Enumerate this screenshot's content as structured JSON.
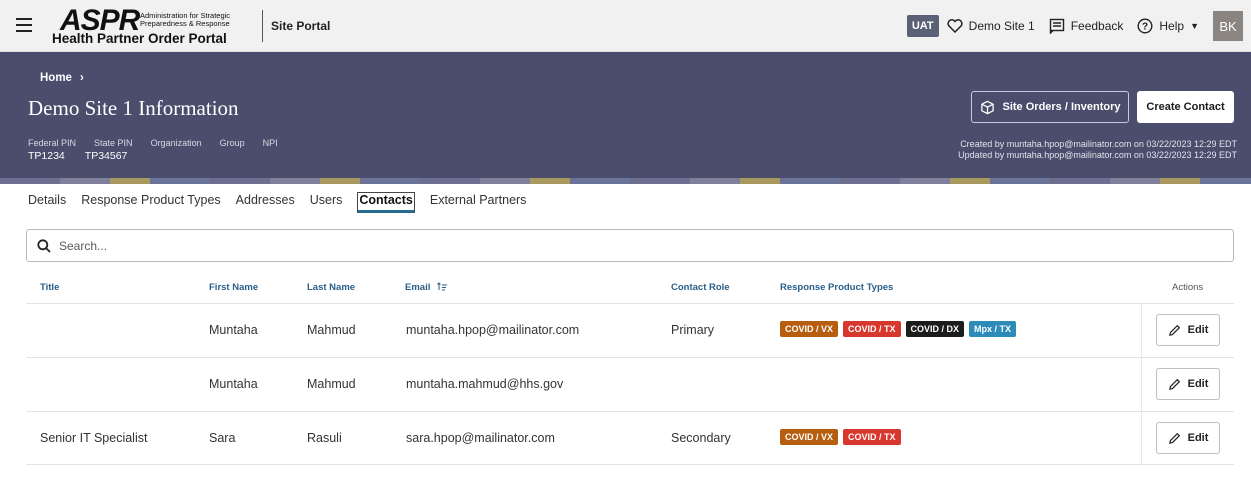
{
  "header": {
    "logo": {
      "wordmark": "ASPR",
      "tagline": "Administration for Strategic Preparedness & Response",
      "subtitle": "Health Partner Order Portal"
    },
    "portal_name": "Site Portal",
    "env_badge": "UAT",
    "site_link": "Demo Site 1",
    "feedback_label": "Feedback",
    "help_label": "Help",
    "avatar_initials": "BK"
  },
  "hero": {
    "breadcrumb": "Home",
    "title": "Demo Site 1 Information",
    "meta_labels": [
      "Federal PIN",
      "State PIN",
      "Organization",
      "Group",
      "NPI"
    ],
    "meta_values": {
      "federal_pin": "TP1234",
      "state_pin": "TP34567"
    },
    "created": "Created by muntaha.hpop@mailinator.com on 03/22/2023 12:29 EDT",
    "updated": "Updated by muntaha.hpop@mailinator.com on 03/22/2023 12:29 EDT",
    "orders_button": "Site Orders / Inventory",
    "create_button": "Create Contact"
  },
  "tabs": [
    "Details",
    "Response Product Types",
    "Addresses",
    "Users",
    "Contacts",
    "External Partners"
  ],
  "active_tab": "Contacts",
  "search": {
    "placeholder": "Search..."
  },
  "table": {
    "headers": {
      "title": "Title",
      "first_name": "First Name",
      "last_name": "Last Name",
      "email": "Email",
      "contact_role": "Contact Role",
      "product_types": "Response Product Types",
      "actions": "Actions"
    },
    "edit_label": "Edit",
    "rows": [
      {
        "title": "",
        "first_name": "Muntaha",
        "last_name": "Mahmud",
        "email": "muntaha.hpop@mailinator.com",
        "role": "Primary",
        "badges": [
          {
            "label": "COVID / VX",
            "color": "#b75d10"
          },
          {
            "label": "COVID / TX",
            "color": "#d8372d"
          },
          {
            "label": "COVID / DX",
            "color": "#1c1c1c"
          },
          {
            "label": "Mpx / TX",
            "color": "#2c8bb8"
          }
        ]
      },
      {
        "title": "",
        "first_name": "Muntaha",
        "last_name": "Mahmud",
        "email": "muntaha.mahmud@hhs.gov",
        "role": "",
        "badges": []
      },
      {
        "title": "Senior IT Specialist",
        "first_name": "Sara",
        "last_name": "Rasuli",
        "email": "sara.hpop@mailinator.com",
        "role": "Secondary",
        "badges": [
          {
            "label": "COVID / VX",
            "color": "#b75d10"
          },
          {
            "label": "COVID / TX",
            "color": "#d8372d"
          }
        ]
      }
    ]
  },
  "colors": {
    "hero_bg": "#4a4d6b",
    "header_link": "#2a5f8a",
    "tab_underline": "#2a6a8f"
  }
}
